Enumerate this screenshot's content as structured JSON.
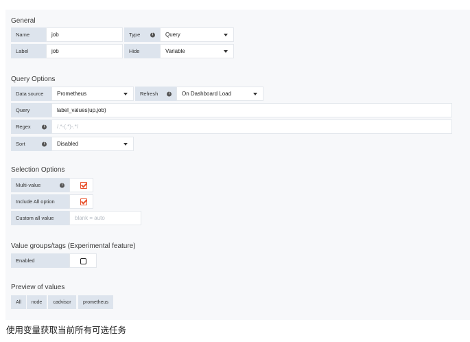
{
  "general": {
    "title": "General",
    "name_label": "Name",
    "name_value": "job",
    "type_label": "Type",
    "type_value": "Query",
    "label_label": "Label",
    "label_value": "job",
    "hide_label": "Hide",
    "hide_value": "Variable"
  },
  "query_options": {
    "title": "Query Options",
    "datasource_label": "Data source",
    "datasource_value": "Prometheus",
    "refresh_label": "Refresh",
    "refresh_value": "On Dashboard Load",
    "query_label": "Query",
    "query_value": "label_values(up,job)",
    "regex_label": "Regex",
    "regex_placeholder": "/.*-(.*)-.*/",
    "sort_label": "Sort",
    "sort_value": "Disabled"
  },
  "selection_options": {
    "title": "Selection Options",
    "multi_value_label": "Multi-value",
    "multi_value_checked": true,
    "include_all_label": "Include All option",
    "include_all_checked": true,
    "custom_all_label": "Custom all value",
    "custom_all_placeholder": "blank = auto"
  },
  "value_groups": {
    "title": "Value groups/tags (Experimental feature)",
    "enabled_label": "Enabled",
    "enabled_checked": false
  },
  "preview": {
    "title": "Preview of values",
    "values": [
      "All",
      "node",
      "cadvisor",
      "prometheus"
    ]
  },
  "caption": "使用变量获取当前所有可选任务",
  "colors": {
    "accent": "#e8512c",
    "label_bg": "#dde4ed",
    "panel_bg": "#f7f8fa"
  },
  "icons": {
    "info": "info-icon",
    "dropdown": "caret-down-icon",
    "checkbox": "checkbox-icon"
  }
}
